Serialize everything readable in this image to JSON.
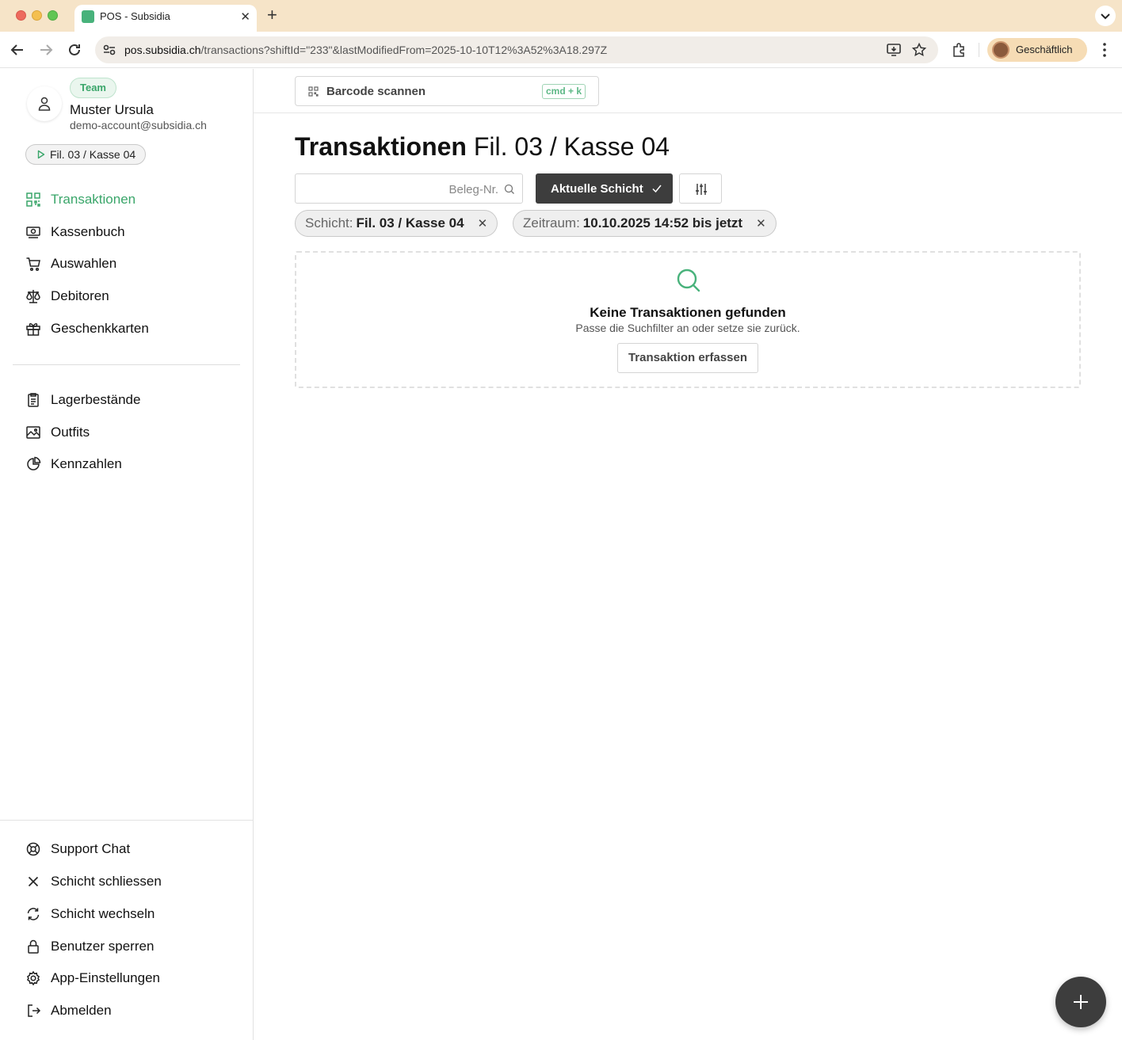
{
  "browser": {
    "tab_title": "POS - Subsidia",
    "url_host": "pos.subsidia.ch",
    "url_path": "/transactions?shiftId=\"233\"&lastModifiedFrom=2025-10-10T12%3A52%3A18.297Z",
    "profile_name": "Geschäftlich"
  },
  "user": {
    "badge": "Team",
    "name": "Muster Ursula",
    "email": "demo-account@subsidia.ch",
    "shift": "Fil. 03 / Kasse 04"
  },
  "nav": {
    "primary": [
      {
        "label": "Transaktionen",
        "icon": "qr-icon",
        "active": true
      },
      {
        "label": "Kassenbuch",
        "icon": "cash-icon"
      },
      {
        "label": "Auswahlen",
        "icon": "cart-icon"
      },
      {
        "label": "Debitoren",
        "icon": "scale-icon"
      },
      {
        "label": "Geschenkkarten",
        "icon": "gift-icon"
      }
    ],
    "secondary": [
      {
        "label": "Lagerbestände",
        "icon": "clipboard-icon"
      },
      {
        "label": "Outfits",
        "icon": "image-icon"
      },
      {
        "label": "Kennzahlen",
        "icon": "pie-chart-icon"
      }
    ],
    "footer": [
      {
        "label": "Support Chat",
        "icon": "lifebuoy-icon"
      },
      {
        "label": "Schicht schliessen",
        "icon": "close-icon"
      },
      {
        "label": "Schicht wechseln",
        "icon": "refresh-icon"
      },
      {
        "label": "Benutzer sperren",
        "icon": "lock-icon"
      },
      {
        "label": "App-Einstellungen",
        "icon": "gear-icon"
      },
      {
        "label": "Abmelden",
        "icon": "logout-icon"
      }
    ]
  },
  "topbar": {
    "barcode_label": "Barcode scannen",
    "shortcut": "cmd + k"
  },
  "page": {
    "title": "Transaktionen",
    "subtitle": "Fil. 03 / Kasse 04",
    "search_placeholder": "Beleg-Nr.",
    "current_shift_button": "Aktuelle Schicht",
    "filters": [
      {
        "key": "Schicht:",
        "value": "Fil. 03 / Kasse 04"
      },
      {
        "key": "Zeitraum:",
        "value": "10.10.2025 14:52 bis jetzt"
      }
    ]
  },
  "empty_state": {
    "title": "Keine Transaktionen gefunden",
    "message": "Passe die Suchfilter an oder setze sie zurück.",
    "button": "Transaktion erfassen"
  },
  "colors": {
    "accent": "#3aa66a",
    "dark_button": "#3d3d3d",
    "tabbar": "#f6e4c8"
  }
}
